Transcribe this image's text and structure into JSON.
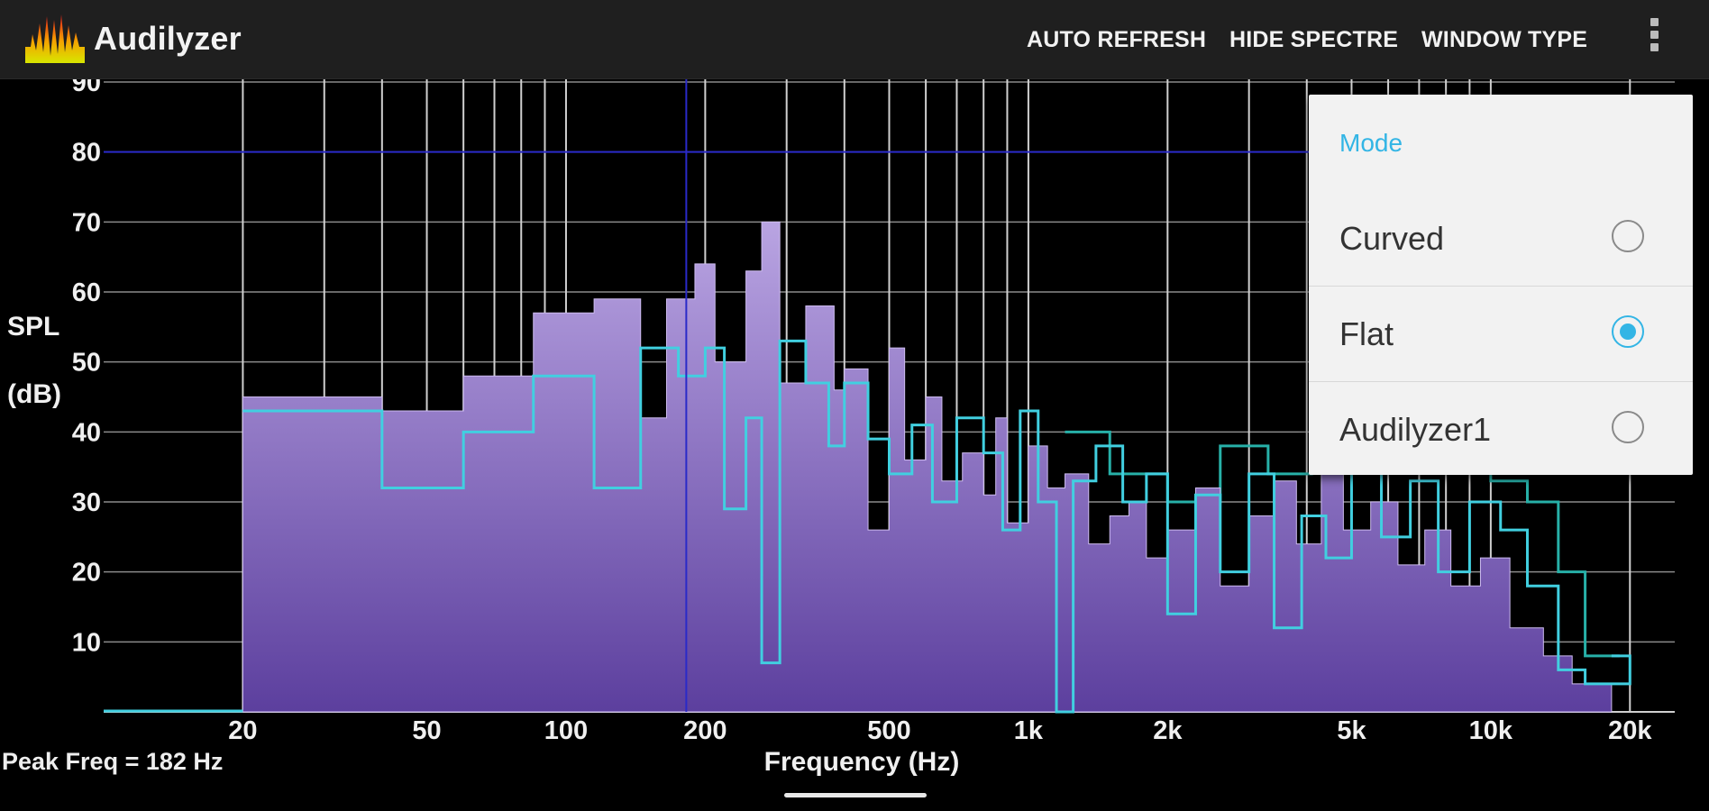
{
  "app": {
    "title": "Audilyzer"
  },
  "toolbar": {
    "auto_refresh": "AUTO REFRESH",
    "hide_spectre": "HIDE SPECTRE",
    "window_type": "WINDOW TYPE",
    "overflow_icon": "more-vert-icon"
  },
  "popup": {
    "title": "Mode",
    "options": [
      {
        "label": "Curved",
        "selected": false
      },
      {
        "label": "Flat",
        "selected": true
      },
      {
        "label": "Audilyzer1",
        "selected": false
      }
    ]
  },
  "status": {
    "peak": "Peak Freq = 182 Hz"
  },
  "colors": {
    "purple_top": "#b9a4e2",
    "purple_bottom": "#5c3f9e",
    "cyan": "#41cfe0",
    "teal": "#27b0a8",
    "cursor": "#2a2ac8",
    "accent": "#33b5e5"
  },
  "chart_data": {
    "type": "area",
    "title": "",
    "xlabel": "Frequency (Hz)",
    "ylabel_lines": [
      "SPL",
      "(dB)"
    ],
    "x_scale": "log",
    "xlim": [
      10,
      25000
    ],
    "ylim": [
      0,
      90
    ],
    "x_ticks": [
      {
        "v": 20,
        "label": "20"
      },
      {
        "v": 50,
        "label": "50"
      },
      {
        "v": 100,
        "label": "100"
      },
      {
        "v": 200,
        "label": "200"
      },
      {
        "v": 500,
        "label": "500"
      },
      {
        "v": 1000,
        "label": "1k"
      },
      {
        "v": 2000,
        "label": "2k"
      },
      {
        "v": 5000,
        "label": "5k"
      },
      {
        "v": 10000,
        "label": "10k"
      },
      {
        "v": 20000,
        "label": "20k"
      }
    ],
    "y_ticks": [
      10,
      20,
      30,
      40,
      50,
      60,
      70,
      80,
      90
    ],
    "peak_marker": {
      "freq": 182,
      "level": 80
    },
    "series": [
      {
        "name": "",
        "style": "purple-filled-steps",
        "points": [
          [
            20,
            45
          ],
          [
            40,
            43
          ],
          [
            60,
            48
          ],
          [
            85,
            57
          ],
          [
            115,
            59
          ],
          [
            145,
            42
          ],
          [
            165,
            59
          ],
          [
            190,
            64
          ],
          [
            210,
            50
          ],
          [
            245,
            63
          ],
          [
            265,
            70
          ],
          [
            290,
            47
          ],
          [
            330,
            58
          ],
          [
            380,
            46
          ],
          [
            400,
            49
          ],
          [
            450,
            26
          ],
          [
            500,
            52
          ],
          [
            540,
            36
          ],
          [
            600,
            45
          ],
          [
            650,
            33
          ],
          [
            720,
            37
          ],
          [
            800,
            31
          ],
          [
            850,
            42
          ],
          [
            900,
            27
          ],
          [
            1000,
            38
          ],
          [
            1100,
            32
          ],
          [
            1200,
            34
          ],
          [
            1350,
            24
          ],
          [
            1500,
            28
          ],
          [
            1650,
            30
          ],
          [
            1800,
            22
          ],
          [
            2000,
            26
          ],
          [
            2300,
            32
          ],
          [
            2600,
            18
          ],
          [
            3000,
            28
          ],
          [
            3400,
            33
          ],
          [
            3800,
            24
          ],
          [
            4300,
            35
          ],
          [
            4800,
            26
          ],
          [
            5500,
            30
          ],
          [
            6300,
            21
          ],
          [
            7200,
            26
          ],
          [
            8200,
            18
          ],
          [
            9500,
            22
          ],
          [
            11000,
            12
          ],
          [
            13000,
            8
          ],
          [
            15000,
            4
          ]
        ]
      },
      {
        "name": "",
        "style": "cyan-step-line",
        "points": [
          [
            20,
            43
          ],
          [
            40,
            32
          ],
          [
            60,
            40
          ],
          [
            85,
            48
          ],
          [
            115,
            32
          ],
          [
            145,
            52
          ],
          [
            175,
            48
          ],
          [
            200,
            52
          ],
          [
            220,
            29
          ],
          [
            245,
            42
          ],
          [
            265,
            7
          ],
          [
            290,
            53
          ],
          [
            330,
            47
          ],
          [
            370,
            38
          ],
          [
            400,
            47
          ],
          [
            450,
            39
          ],
          [
            500,
            34
          ],
          [
            560,
            41
          ],
          [
            620,
            30
          ],
          [
            700,
            42
          ],
          [
            800,
            37
          ],
          [
            880,
            26
          ],
          [
            960,
            43
          ],
          [
            1050,
            30
          ],
          [
            1150,
            0
          ],
          [
            1250,
            33
          ],
          [
            1400,
            38
          ],
          [
            1600,
            30
          ],
          [
            1800,
            34
          ],
          [
            2000,
            14
          ],
          [
            2300,
            31
          ],
          [
            2600,
            20
          ],
          [
            3000,
            34
          ],
          [
            3400,
            12
          ],
          [
            3900,
            28
          ],
          [
            4400,
            22
          ],
          [
            5000,
            36
          ],
          [
            5800,
            25
          ],
          [
            6700,
            33
          ],
          [
            7700,
            20
          ],
          [
            9000,
            30
          ],
          [
            10500,
            26
          ],
          [
            12000,
            18
          ],
          [
            14000,
            6
          ],
          [
            16000,
            4
          ],
          [
            20000,
            8
          ]
        ]
      },
      {
        "name": "",
        "style": "teal-dense",
        "points": [
          [
            1200,
            40
          ],
          [
            1500,
            34
          ],
          [
            2000,
            30
          ],
          [
            2600,
            38
          ],
          [
            3300,
            34
          ],
          [
            4100,
            36
          ],
          [
            5000,
            40
          ],
          [
            6000,
            37
          ],
          [
            7000,
            38
          ],
          [
            8500,
            35
          ],
          [
            10000,
            33
          ],
          [
            12000,
            30
          ],
          [
            14000,
            20
          ],
          [
            16000,
            8
          ],
          [
            19000,
            8
          ]
        ]
      }
    ]
  }
}
